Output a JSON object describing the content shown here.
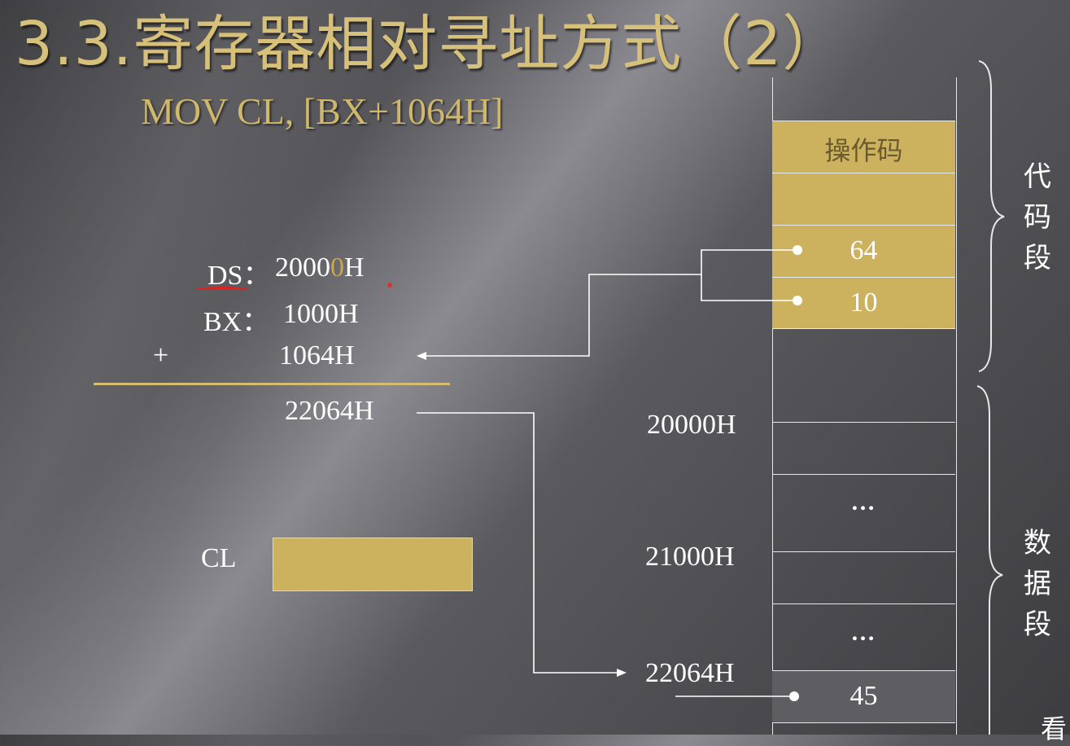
{
  "title": "3.3.寄存器相对寻址方式（2）",
  "instruction": "MOV  CL, [BX+1064H]",
  "calc": {
    "ds_label": "DS：",
    "ds_value_prefix": "2000",
    "ds_value_highlight": "0",
    "ds_value_suffix": "H",
    "bx_label": "BX：",
    "bx_value": "1000H",
    "plus": "+",
    "disp_value": "1064H",
    "result": "22064H"
  },
  "register": {
    "label": "CL"
  },
  "code_segment": {
    "label": "代码段",
    "label_chars": [
      "代",
      "码",
      "段"
    ],
    "opcode": "操作码",
    "byte_low": "64",
    "byte_high": "10"
  },
  "data_segment": {
    "label": "数据段",
    "label_chars": [
      "数",
      "据",
      "段"
    ],
    "addresses": [
      "20000H",
      "21000H",
      "22064H"
    ],
    "ellipsis": [
      "…",
      "…"
    ],
    "value": "45"
  },
  "corner_char": "看",
  "colors": {
    "gold": "#ccb25f",
    "title_gold": "#d7c17a",
    "underline_red": "#dd2222"
  }
}
